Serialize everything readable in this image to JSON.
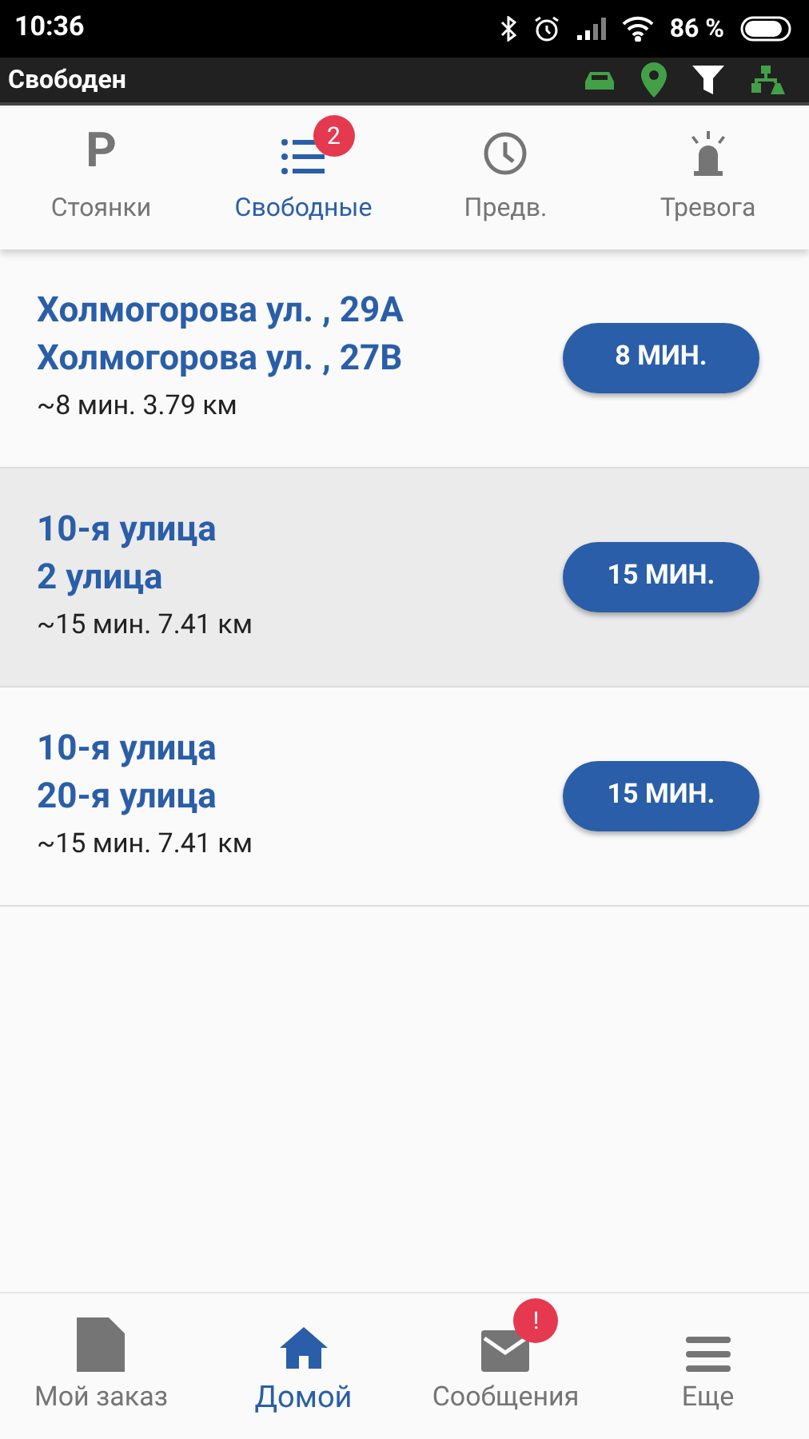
{
  "status_bar": {
    "time": "10:36",
    "battery": "86 %"
  },
  "header": {
    "title": "Свободен"
  },
  "tabs": [
    {
      "kind": "parking",
      "glyph": "P",
      "label": "Стоянки",
      "selected": false
    },
    {
      "kind": "list",
      "label": "Свободные",
      "selected": true,
      "badge": "2"
    },
    {
      "kind": "clock",
      "label": "Предв.",
      "selected": false
    },
    {
      "kind": "alarm",
      "label": "Тревога",
      "selected": false
    }
  ],
  "orders": [
    {
      "from": "Холмогорова ул. , 29А",
      "to": "Холмогорова ул. , 27В",
      "info": "~8 мин. 3.79 км",
      "button": "8 МИН.",
      "selected": false
    },
    {
      "from": "10-я улица",
      "to": "2 улица",
      "info": "~15 мин. 7.41 км",
      "button": "15 МИН.",
      "selected": true
    },
    {
      "from": "10-я улица",
      "to": "20-я улица",
      "info": "~15 мин. 7.41 км",
      "button": "15 МИН.",
      "selected": false
    }
  ],
  "bottom_nav": [
    {
      "kind": "document",
      "label": "Мой заказ",
      "selected": false
    },
    {
      "kind": "home",
      "label": "Домой",
      "selected": true
    },
    {
      "kind": "mail",
      "label": "Сообщения",
      "selected": false,
      "badge": "!"
    },
    {
      "kind": "menu",
      "label": "Еще",
      "selected": false
    }
  ]
}
